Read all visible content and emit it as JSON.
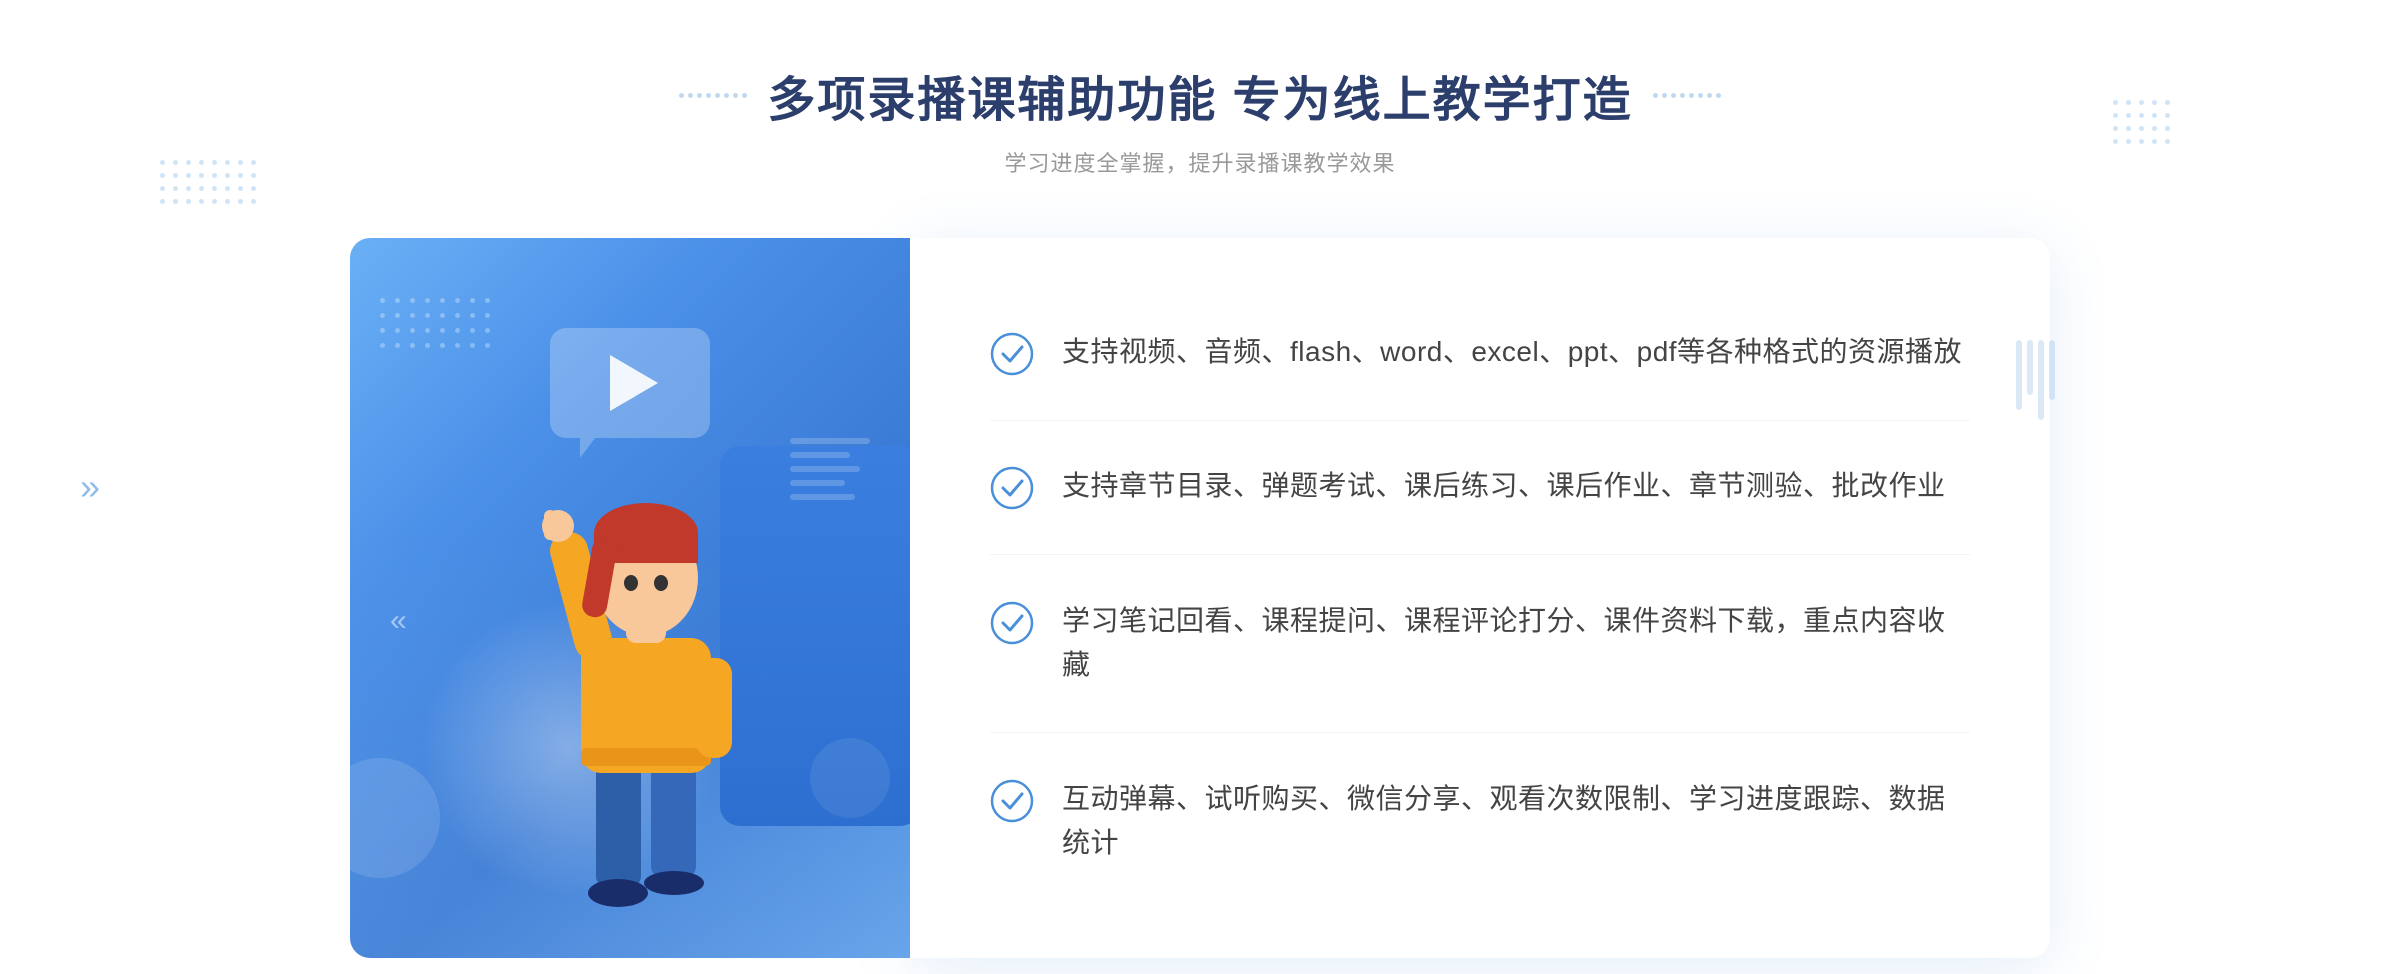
{
  "header": {
    "title": "多项录播课辅助功能 专为线上教学打造",
    "subtitle": "学习进度全掌握，提升录播课教学效果"
  },
  "features": [
    {
      "id": "feature-1",
      "text": "支持视频、音频、flash、word、excel、ppt、pdf等各种格式的资源播放"
    },
    {
      "id": "feature-2",
      "text": "支持章节目录、弹题考试、课后练习、课后作业、章节测验、批改作业"
    },
    {
      "id": "feature-3",
      "text": "学习笔记回看、课程提问、课程评论打分、课件资料下载，重点内容收藏"
    },
    {
      "id": "feature-4",
      "text": "互动弹幕、试听购买、微信分享、观看次数限制、学习进度跟踪、数据统计"
    }
  ],
  "decoration": {
    "check_icon_color": "#4a90d9",
    "title_decoration_dots": "···",
    "chevron_left": "»"
  }
}
